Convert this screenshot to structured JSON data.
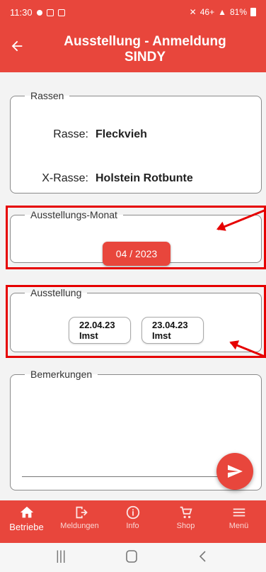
{
  "status_bar": {
    "time": "11:30",
    "signal_text": "46+",
    "battery": "81%"
  },
  "app_bar": {
    "title_line1": "Ausstellung - Anmeldung",
    "title_line2": "SINDY"
  },
  "sections": {
    "rassen": {
      "legend": "Rassen",
      "rasse_label": "Rasse:",
      "rasse_value": "Fleckvieh",
      "x_rasse_label": "X-Rasse:",
      "x_rasse_value": "Holstein Rotbunte"
    },
    "monat": {
      "legend": "Ausstellungs-Monat",
      "selected_month": "04 / 2023"
    },
    "ausstellung": {
      "legend": "Ausstellung",
      "options": [
        {
          "date": "22.04.23",
          "place": "Imst"
        },
        {
          "date": "23.04.23",
          "place": "Imst"
        }
      ]
    },
    "bemerkungen": {
      "legend": "Bemerkungen",
      "value": ""
    }
  },
  "bottom_nav": [
    {
      "label": "Betriebe",
      "icon": "home-icon",
      "active": true
    },
    {
      "label": "Meldungen",
      "icon": "exit-icon",
      "active": false
    },
    {
      "label": "Info",
      "icon": "info-icon",
      "active": false
    },
    {
      "label": "Shop",
      "icon": "cart-icon",
      "active": false
    },
    {
      "label": "Menü",
      "icon": "menu-icon",
      "active": false
    }
  ],
  "colors": {
    "primary": "#e8463c",
    "highlight": "#e60000"
  }
}
